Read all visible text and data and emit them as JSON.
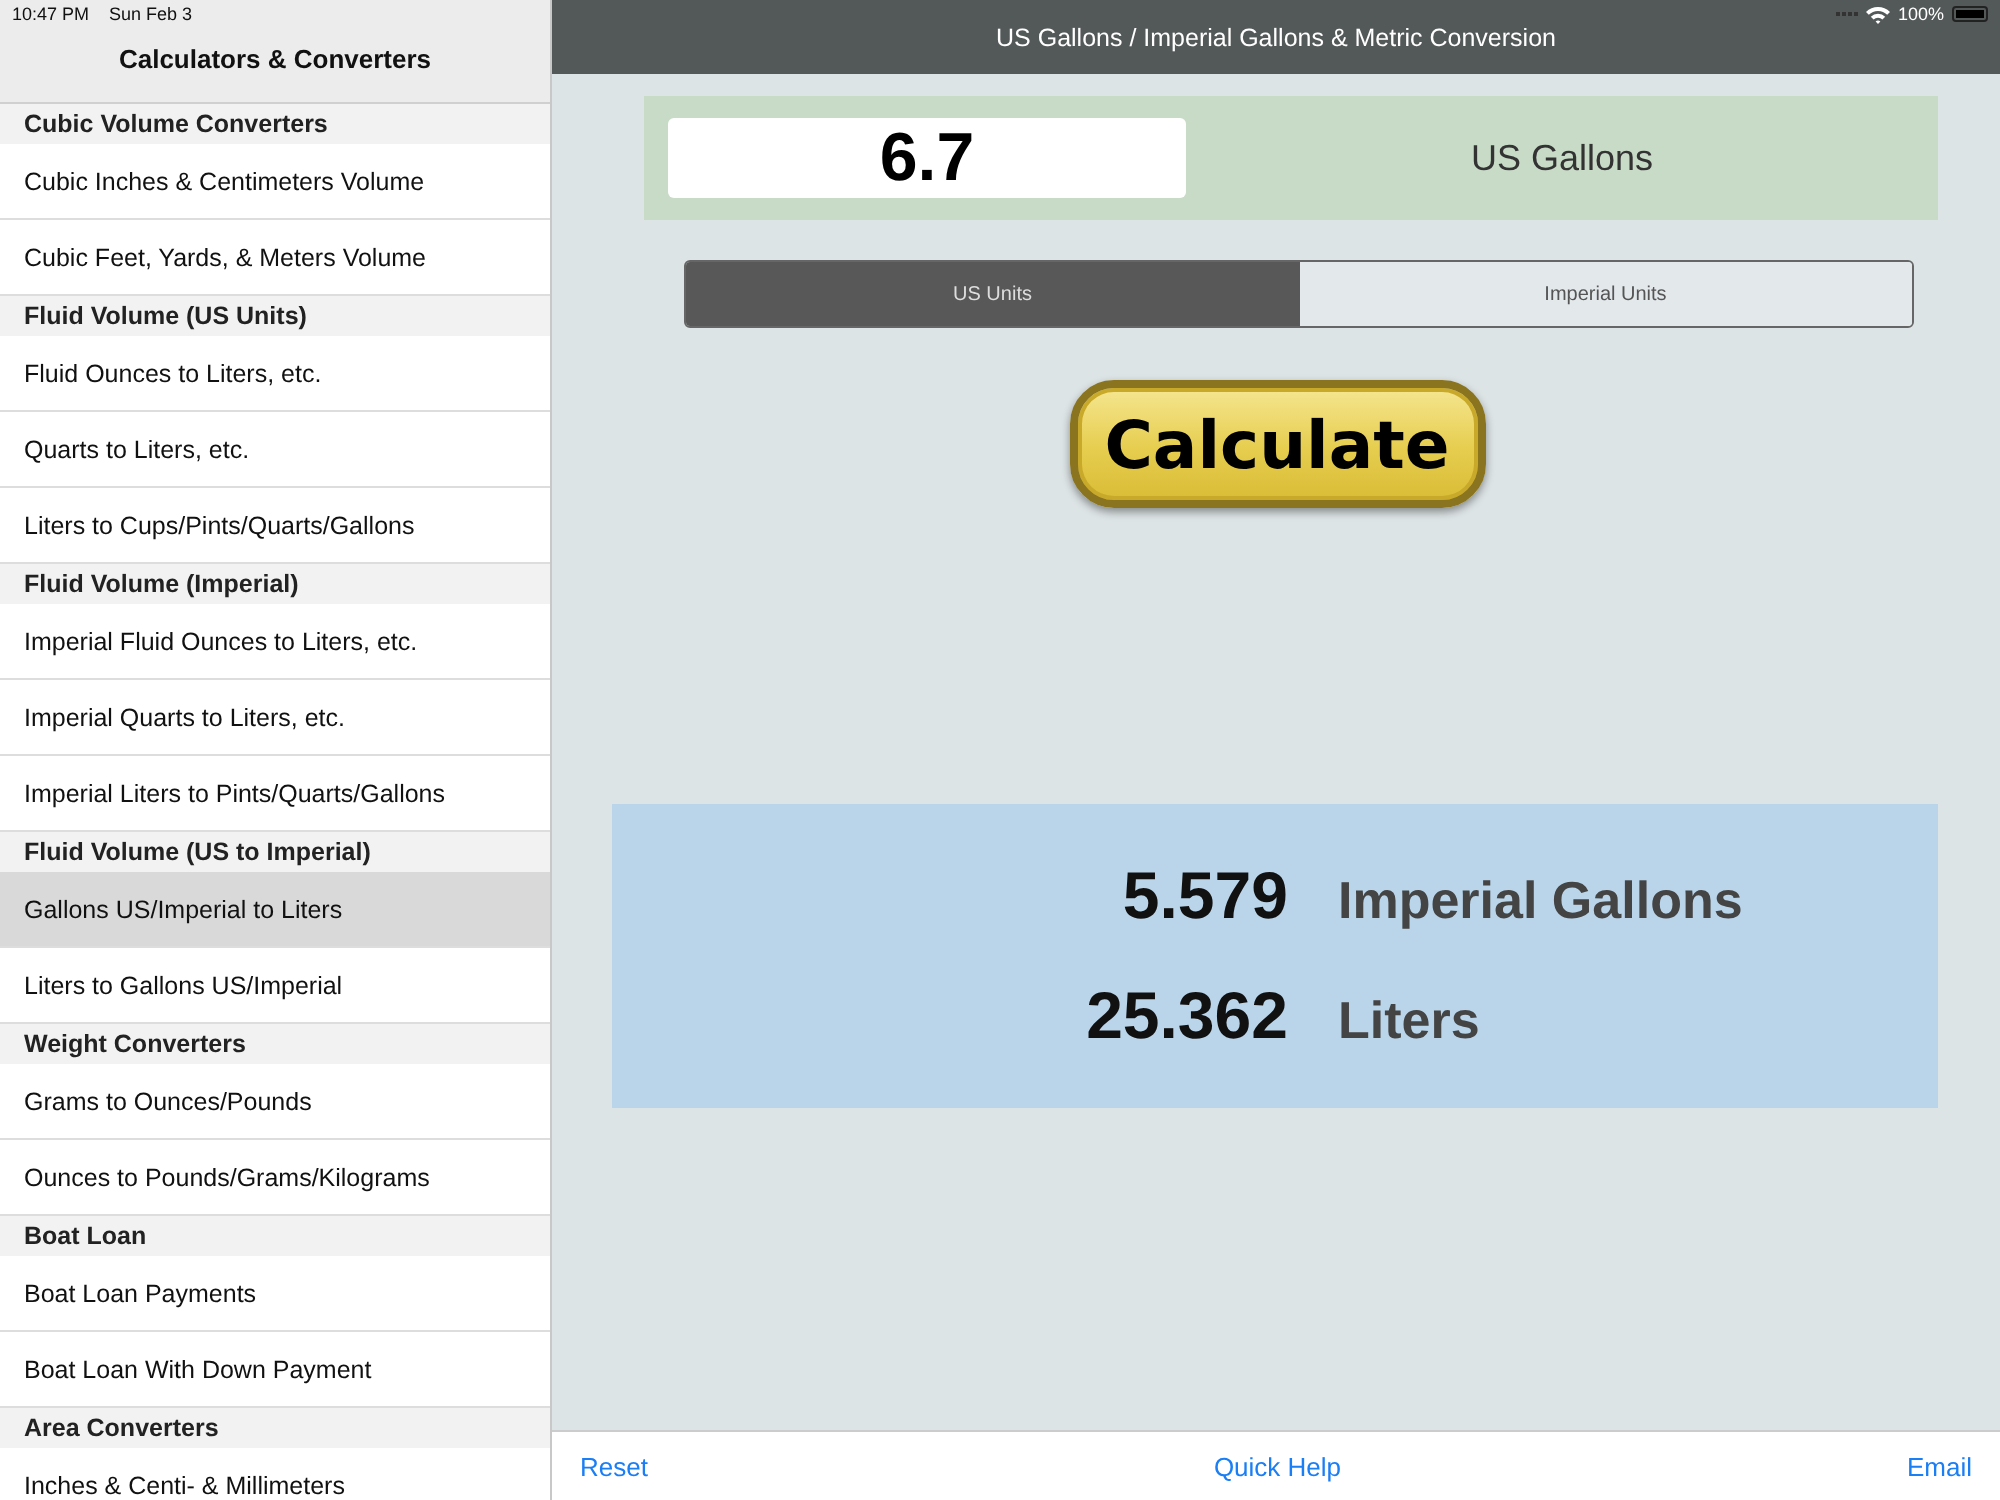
{
  "status_bar": {
    "time": "10:47 PM",
    "date": "Sun Feb 3",
    "battery": "100%"
  },
  "sidebar": {
    "title": "Calculators & Converters",
    "sections": [
      {
        "header": "Cubic Volume Converters",
        "items": [
          {
            "label": "Cubic Inches & Centimeters Volume",
            "selected": false
          },
          {
            "label": "Cubic Feet, Yards, & Meters Volume",
            "selected": false
          }
        ]
      },
      {
        "header": "Fluid Volume (US Units)",
        "items": [
          {
            "label": "Fluid Ounces to Liters, etc.",
            "selected": false
          },
          {
            "label": "Quarts to Liters, etc.",
            "selected": false
          },
          {
            "label": "Liters to Cups/Pints/Quarts/Gallons",
            "selected": false
          }
        ]
      },
      {
        "header": "Fluid Volume (Imperial)",
        "items": [
          {
            "label": "Imperial Fluid Ounces to Liters, etc.",
            "selected": false
          },
          {
            "label": "Imperial Quarts to Liters, etc.",
            "selected": false
          },
          {
            "label": "Imperial Liters to Pints/Quarts/Gallons",
            "selected": false
          }
        ]
      },
      {
        "header": "Fluid Volume (US to Imperial)",
        "items": [
          {
            "label": "Gallons US/Imperial to Liters",
            "selected": true
          },
          {
            "label": "Liters to Gallons US/Imperial",
            "selected": false
          }
        ]
      },
      {
        "header": "Weight Converters",
        "items": [
          {
            "label": "Grams to Ounces/Pounds",
            "selected": false
          },
          {
            "label": "Ounces to Pounds/Grams/Kilograms",
            "selected": false
          }
        ]
      },
      {
        "header": "Boat Loan",
        "items": [
          {
            "label": "Boat Loan Payments",
            "selected": false
          },
          {
            "label": "Boat Loan With Down Payment",
            "selected": false
          }
        ]
      },
      {
        "header": "Area Converters",
        "items": [
          {
            "label": "Inches & Centi- & Millimeters",
            "selected": false
          }
        ]
      }
    ]
  },
  "main": {
    "title": "US Gallons / Imperial Gallons & Metric Conversion",
    "input": {
      "value": "6.7",
      "unit": "US Gallons"
    },
    "segments": [
      {
        "label": "US Units",
        "selected": true
      },
      {
        "label": "Imperial Units",
        "selected": false
      }
    ],
    "calculate_button": "Calculate",
    "results": [
      {
        "value": "5.579",
        "unit": "Imperial Gallons"
      },
      {
        "value": "25.362",
        "unit": "Liters"
      }
    ]
  },
  "toolbar": [
    "Reset",
    "Quick Help",
    "Email"
  ]
}
